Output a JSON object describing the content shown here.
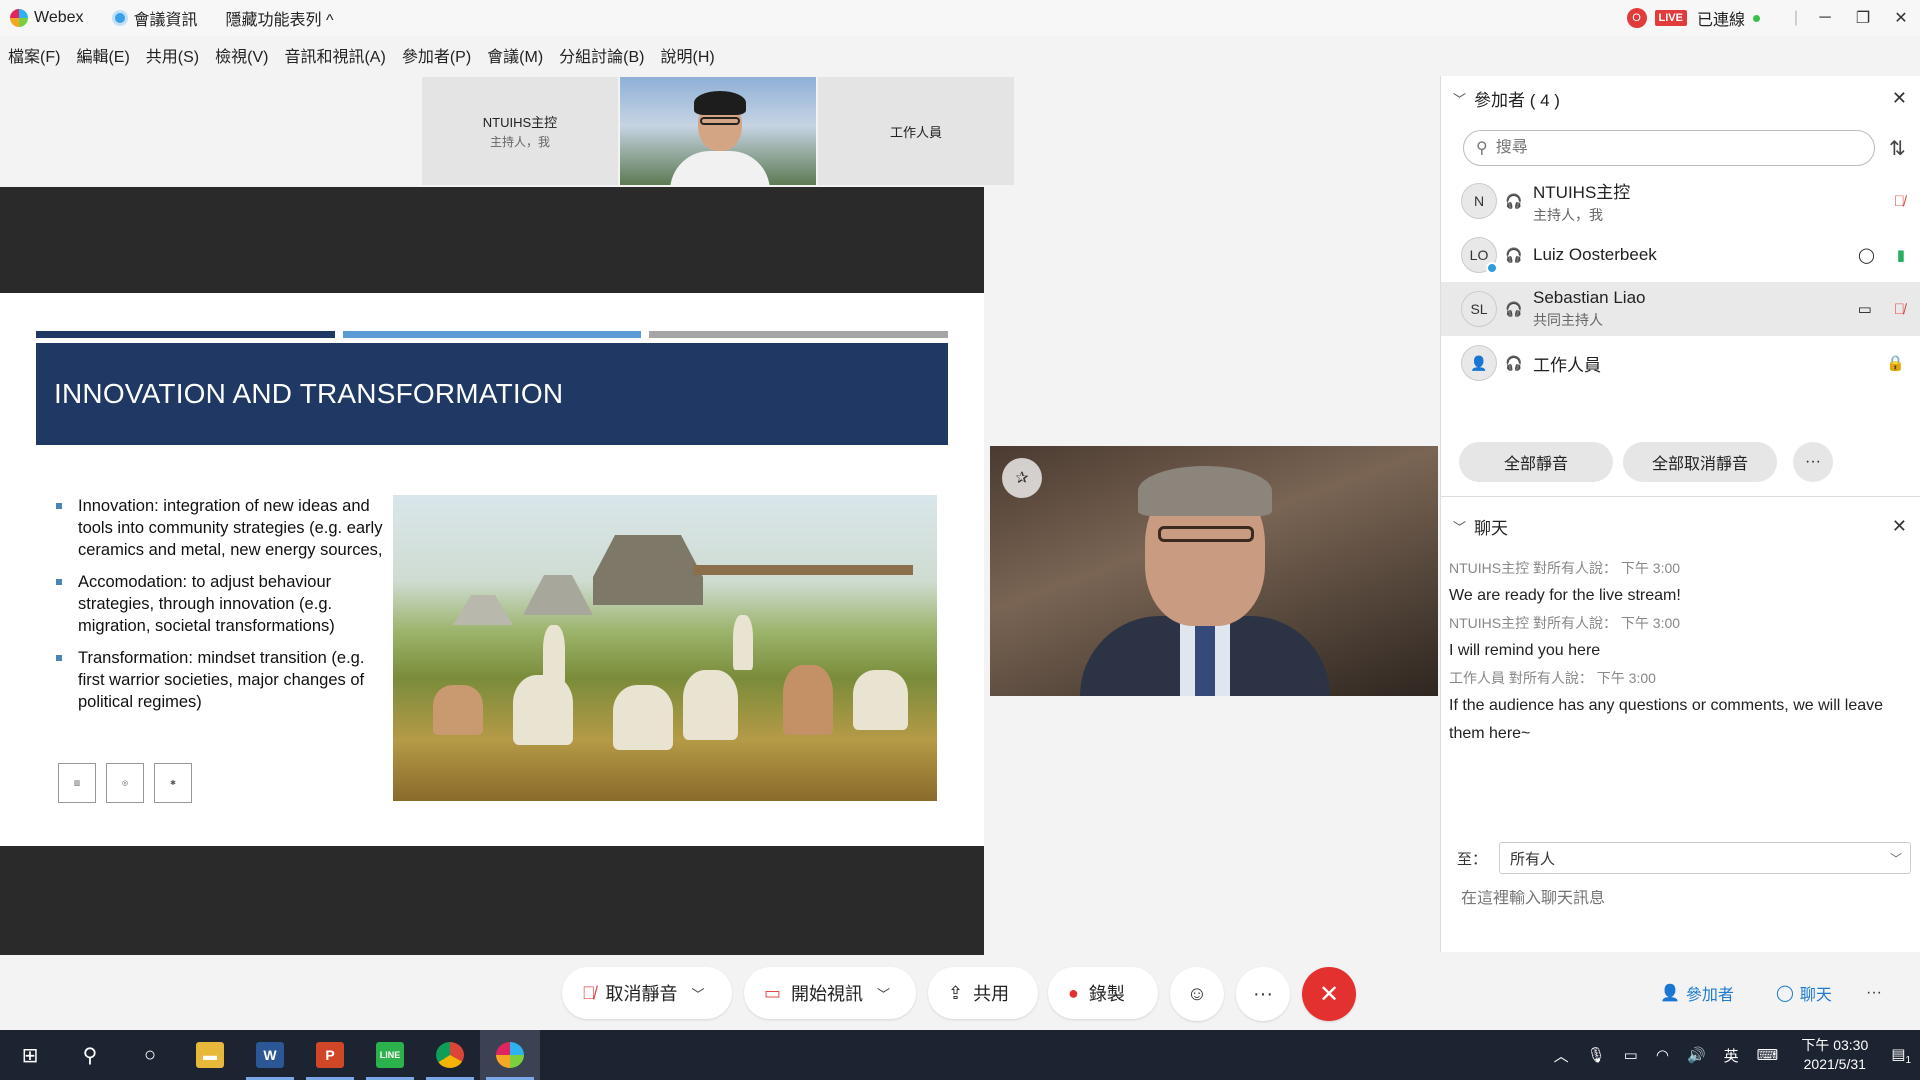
{
  "titlebar": {
    "app_name": "Webex",
    "meeting_info": "會議資訊",
    "hide_menu": "隱藏功能表列 ^",
    "rec_indicator": "O",
    "live_badge": "LIVE",
    "connection": "已連線"
  },
  "menubar": [
    "檔案(F)",
    "編輯(E)",
    "共用(S)",
    "檢視(V)",
    "音訊和視訊(A)",
    "參加者(P)",
    "會議(M)",
    "分組討論(B)",
    "說明(H)"
  ],
  "thumbnails": [
    {
      "name": "NTUIHS主控",
      "sub": "主持人，我"
    },
    {
      "name": "",
      "sub": ""
    },
    {
      "name": "工作人員",
      "sub": ""
    }
  ],
  "slide": {
    "title": "INNOVATION AND TRANSFORMATION",
    "bullets": [
      "Innovation: integration of new ideas and tools into community strategies (e.g. early ceramics and metal, new energy sources,",
      "Accomodation: to adjust behaviour strategies, through innovation (e.g. migration, societal transformations)",
      "Transformation: mindset transition (e.g. first warrior societies, major changes of political regimes)"
    ],
    "bar_colors": [
      "#1f3864",
      "#5b9bd5",
      "#a5a5a5"
    ]
  },
  "participants_panel": {
    "title": "參加者 ( 4 )",
    "search_placeholder": "搜尋",
    "participants": [
      {
        "initials": "N",
        "name": "NTUIHS主控",
        "role": "主持人，我"
      },
      {
        "initials": "LO",
        "name": "Luiz Oosterbeek",
        "role": ""
      },
      {
        "initials": "SL",
        "name": "Sebastian Liao",
        "role": "共同主持人"
      },
      {
        "initials": "",
        "name": "工作人員",
        "role": ""
      }
    ],
    "mute_all": "全部靜音",
    "unmute_all": "全部取消靜音",
    "more": "···"
  },
  "chat_panel": {
    "title": "聊天",
    "messages": [
      {
        "meta": "NTUIHS主控 對所有人說：   下午 3:00",
        "text": "We are ready for the live stream!"
      },
      {
        "meta": "NTUIHS主控 對所有人說：   下午 3:00",
        "text": "I will remind you here"
      },
      {
        "meta": "工作人員 對所有人說：   下午 3:00",
        "text": "If the audience has any questions or comments, we will leave them here~"
      }
    ],
    "to_label": "至：",
    "to_value": "所有人",
    "input_placeholder": "在這裡輸入聊天訊息"
  },
  "controls": {
    "unmute": "取消靜音",
    "start_video": "開始視訊",
    "share": "共用",
    "record": "錄製",
    "more": "···",
    "participants": "參加者",
    "chat": "聊天",
    "more_right": "···"
  },
  "taskbar": {
    "ime": "英",
    "time": "下午 03:30",
    "date": "2021/5/31",
    "notif_count": "1"
  },
  "colors": {
    "end_call": "#e3312f",
    "slide_title_bg": "#1f3864",
    "live": "#e23b3b"
  }
}
